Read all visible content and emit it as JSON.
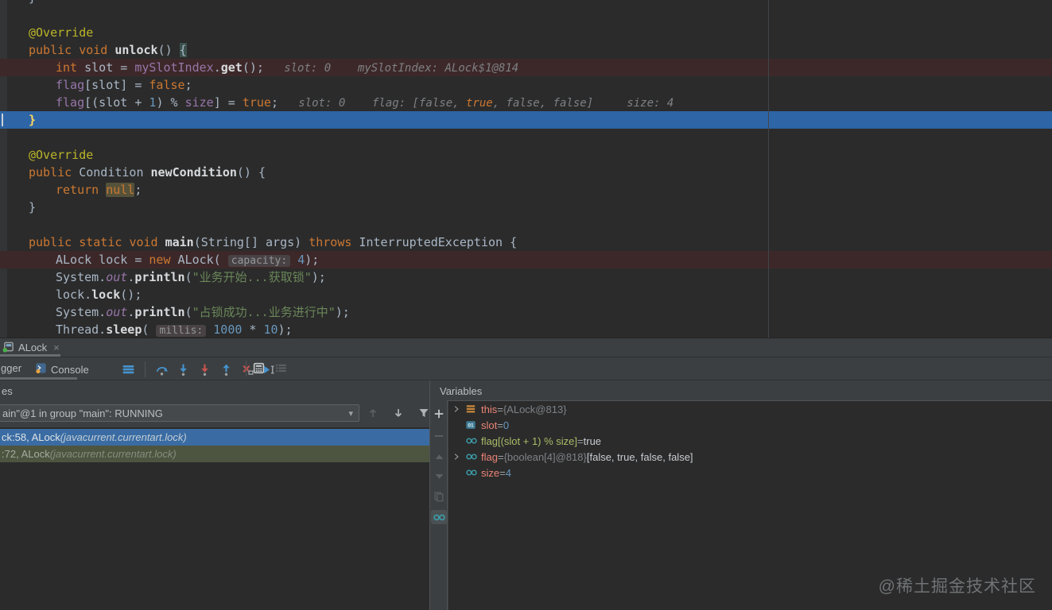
{
  "watermark": "@稀土掘金技术社区",
  "editor": {
    "lines": [
      {
        "indent": 0,
        "tokens": [
          [
            "pl",
            "}"
          ]
        ]
      },
      {
        "tokens": []
      },
      {
        "indent": 0,
        "tokens": [
          [
            "ann",
            "@Override"
          ]
        ]
      },
      {
        "indent": 0,
        "tokens": [
          [
            "kw",
            "public "
          ],
          [
            "kw",
            "void "
          ],
          [
            "fn",
            "unlock"
          ],
          [
            "pl",
            "() "
          ],
          [
            "bracehl",
            "{"
          ]
        ]
      },
      {
        "bg": "bp",
        "indent": 1,
        "tokens": [
          [
            "kw",
            "int "
          ],
          [
            "pl",
            "slot = "
          ],
          [
            "fld",
            "mySlotIndex"
          ],
          [
            "pl",
            "."
          ],
          [
            "fn",
            "get"
          ],
          [
            "pl",
            "();"
          ],
          [
            "hint",
            "   slot: 0"
          ],
          [
            "hint",
            "    mySlotIndex: ALock$1@814"
          ]
        ]
      },
      {
        "indent": 1,
        "tokens": [
          [
            "fld",
            "flag"
          ],
          [
            "pl",
            "[slot] = "
          ],
          [
            "kw",
            "false"
          ],
          [
            "pl",
            ";"
          ]
        ]
      },
      {
        "indent": 1,
        "tokens": [
          [
            "fld",
            "flag"
          ],
          [
            "pl",
            "[(slot + "
          ],
          [
            "num",
            "1"
          ],
          [
            "pl",
            ") % "
          ],
          [
            "fld",
            "size"
          ],
          [
            "pl",
            "] = "
          ],
          [
            "kw",
            "true"
          ],
          [
            "pl",
            ";"
          ],
          [
            "hint",
            "   slot: 0"
          ],
          [
            "hint",
            "    flag: [false, "
          ],
          [
            "hinthl",
            "true"
          ],
          [
            "hint",
            ", false, false]"
          ],
          [
            "hint",
            "     size: 4"
          ]
        ]
      },
      {
        "bg": "exec",
        "indent": 0,
        "tokens": [
          [
            "bracey",
            "}"
          ]
        ]
      },
      {
        "tokens": []
      },
      {
        "indent": 0,
        "tokens": [
          [
            "ann",
            "@Override"
          ]
        ]
      },
      {
        "indent": 0,
        "tokens": [
          [
            "kw",
            "public "
          ],
          [
            "pl",
            "Condition "
          ],
          [
            "fn",
            "newCondition"
          ],
          [
            "pl",
            "() {"
          ]
        ]
      },
      {
        "indent": 1,
        "tokens": [
          [
            "kw",
            "return "
          ],
          [
            "nullhl",
            "null"
          ],
          [
            "pl",
            ";"
          ]
        ]
      },
      {
        "indent": 0,
        "tokens": [
          [
            "pl",
            "}"
          ]
        ]
      },
      {
        "tokens": []
      },
      {
        "indent": 0,
        "tokens": [
          [
            "kw",
            "public static "
          ],
          [
            "kw",
            "void "
          ],
          [
            "fn",
            "main"
          ],
          [
            "pl",
            "(String[] args) "
          ],
          [
            "kw",
            "throws "
          ],
          [
            "pl",
            "InterruptedException {"
          ]
        ]
      },
      {
        "bg": "bp",
        "indent": 1,
        "tokens": [
          [
            "pl",
            "ALock lock = "
          ],
          [
            "kw",
            "new "
          ],
          [
            "pl",
            "ALock( "
          ],
          [
            "badge",
            "capacity:"
          ],
          [
            "num",
            " 4"
          ],
          [
            "pl",
            ");"
          ]
        ]
      },
      {
        "indent": 1,
        "tokens": [
          [
            "pl",
            "System."
          ],
          [
            "fldi",
            "out"
          ],
          [
            "pl",
            "."
          ],
          [
            "fn",
            "println"
          ],
          [
            "pl",
            "("
          ],
          [
            "str",
            "\"业务开始...获取锁\""
          ],
          [
            "pl",
            ");"
          ]
        ]
      },
      {
        "indent": 1,
        "tokens": [
          [
            "pl",
            "lock."
          ],
          [
            "fn",
            "lock"
          ],
          [
            "pl",
            "();"
          ]
        ]
      },
      {
        "indent": 1,
        "tokens": [
          [
            "pl",
            "System."
          ],
          [
            "fldi",
            "out"
          ],
          [
            "pl",
            "."
          ],
          [
            "fn",
            "println"
          ],
          [
            "pl",
            "("
          ],
          [
            "str",
            "\"占锁成功...业务进行中\""
          ],
          [
            "pl",
            ");"
          ]
        ]
      },
      {
        "indent": 1,
        "tokens": [
          [
            "pl",
            "Thread."
          ],
          [
            "fn",
            "sleep"
          ],
          [
            "pl",
            "( "
          ],
          [
            "badge",
            "millis:"
          ],
          [
            "num",
            " 1000 "
          ],
          [
            "pl",
            "* "
          ],
          [
            "num",
            "10"
          ],
          [
            "pl",
            ");"
          ]
        ]
      }
    ]
  },
  "debug": {
    "tab": {
      "title": "ALock",
      "close": "×"
    },
    "toolbar": {
      "debugger_tab": "gger",
      "console_tab": "Console",
      "step_buttons": [
        "hamburger-icon",
        "sep",
        "step-over-icon",
        "step-into-icon",
        "force-step-into-icon",
        "step-out-icon",
        "drop-frame-icon",
        "run-to-cursor-icon"
      ],
      "right_buttons": [
        "evaluate-expression-icon",
        "layout-settings-icon"
      ]
    },
    "frames": {
      "header": "es",
      "thread": "ain\"@1 in group \"main\": RUNNING",
      "dropdown_caret": "▾",
      "toolbar": [
        "up-arrow-icon",
        "down-arrow-icon",
        "filter-icon"
      ],
      "rows": [
        {
          "main": "ck:58, ALock ",
          "pkg": "(javacurrent.currentart.lock)",
          "state": "selected"
        },
        {
          "main": ":72, ALock ",
          "pkg": "(javacurrent.currentart.lock)",
          "state": "library"
        }
      ]
    },
    "watch_toolbar": [
      "add-watch-icon",
      "remove-watch-icon",
      "move-up-icon",
      "move-down-icon",
      "duplicate-icon",
      "show-watches-icon"
    ],
    "variables": {
      "header": "Variables",
      "primitive_icon_label": "01",
      "rows": [
        {
          "expand": true,
          "icon": "object-icon",
          "name": "this",
          "nclass": "v-name",
          "eq": " = ",
          "value": "{ALock@813}",
          "vclass": "v-ref"
        },
        {
          "expand": false,
          "icon": "primitive-icon",
          "name": "slot",
          "nclass": "v-name",
          "eq": " = ",
          "value": "0",
          "vclass": "v-num"
        },
        {
          "expand": false,
          "icon": "watch-icon",
          "name": "flag[(slot + 1) % size]",
          "nclass": "v-expr",
          "eq": " = ",
          "value": "true",
          "vclass": "v-plain"
        },
        {
          "expand": true,
          "icon": "watch-icon",
          "name": "flag",
          "nclass": "v-name",
          "eq": " = ",
          "value": "{boolean[4]@818} ",
          "value2": "[false, true, false, false]",
          "vclass": "v-ref",
          "v2class": "v-plain"
        },
        {
          "expand": false,
          "icon": "watch-icon",
          "name": "size",
          "nclass": "v-name",
          "eq": " = ",
          "value": "4",
          "vclass": "v-num"
        }
      ]
    }
  }
}
